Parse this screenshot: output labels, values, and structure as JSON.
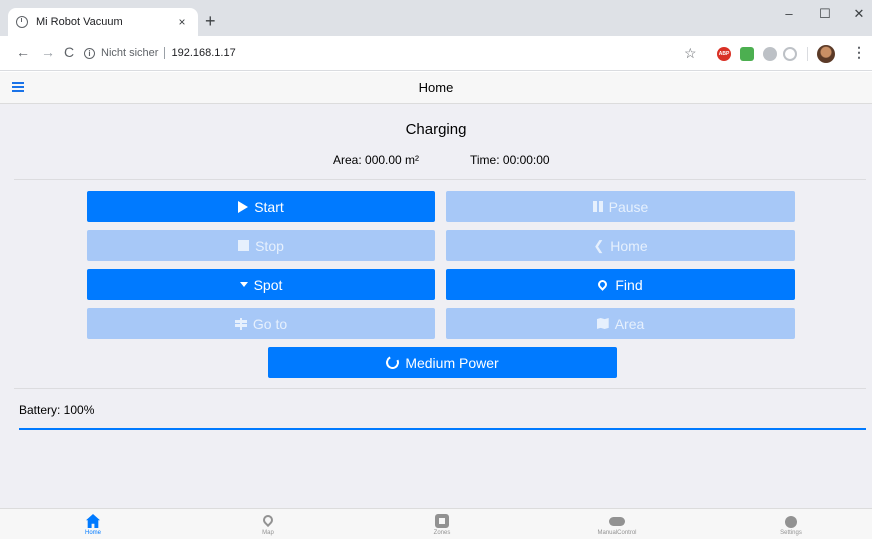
{
  "browser": {
    "tab_title": "Mi Robot Vacuum",
    "tab_close": "×",
    "new_tab": "+",
    "window_controls": {
      "minimize": "–",
      "maximize": "☐",
      "close": "✕"
    },
    "nav": {
      "back": "←",
      "forward": "→",
      "reload": "C"
    },
    "security_label": "Nicht sicher",
    "url": "192.168.1.17",
    "extensions": [
      "star-icon",
      "adblock-plus-icon",
      "extension-green-icon",
      "extension-grey-icon",
      "extension-ring-icon",
      "profile-avatar",
      "menu-dots-icon"
    ],
    "abp_text": "ABP"
  },
  "header": {
    "title": "Home",
    "menu_icon": "hamburger-icon"
  },
  "status": {
    "state": "Charging",
    "area": "Area: 000.00 m²",
    "time": "Time: 00:00:00"
  },
  "controls": {
    "start": {
      "label": "Start",
      "icon": "play-icon",
      "enabled": true
    },
    "pause": {
      "label": "Pause",
      "icon": "pause-icon",
      "enabled": false
    },
    "stop": {
      "label": "Stop",
      "icon": "stop-icon",
      "enabled": false
    },
    "home": {
      "label": "Home",
      "icon": "home-icon",
      "enabled": false
    },
    "spot": {
      "label": "Spot",
      "icon": "caret-down-icon",
      "enabled": true
    },
    "find": {
      "label": "Find",
      "icon": "map-marker-icon",
      "enabled": true
    },
    "goto": {
      "label": "Go to",
      "icon": "signpost-icon",
      "enabled": false
    },
    "area": {
      "label": "Area",
      "icon": "map-icon",
      "enabled": false
    },
    "power": {
      "label": "Medium Power",
      "icon": "power-cycle-icon",
      "enabled": true
    }
  },
  "battery": {
    "label": "Battery: 100%",
    "level": 1.0
  },
  "tabbar": {
    "items": [
      {
        "label": "Home",
        "icon": "home-icon",
        "active": true
      },
      {
        "label": "Map",
        "icon": "map-marker-icon",
        "active": false
      },
      {
        "label": "Zones",
        "icon": "zones-icon",
        "active": false
      },
      {
        "label": "ManualControl",
        "icon": "gamepad-icon",
        "active": false
      },
      {
        "label": "Settings",
        "icon": "gear-icon",
        "active": false
      }
    ]
  },
  "colors": {
    "accent": "#007aff",
    "disabled_button": "#a7c8f7",
    "background": "#efeff4"
  }
}
